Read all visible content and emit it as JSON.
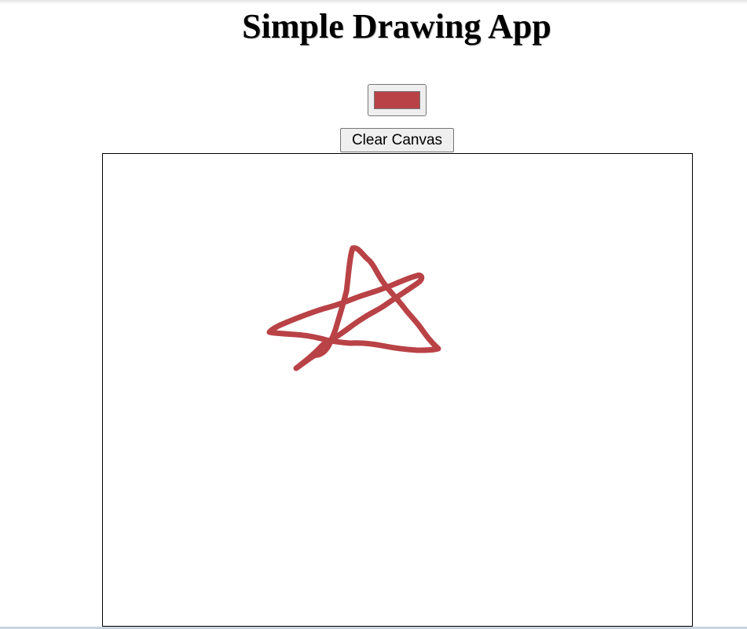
{
  "app": {
    "title": "Simple Drawing App"
  },
  "toolbar": {
    "color_value": "#b94246",
    "clear_label": "Clear Canvas"
  },
  "canvas": {
    "stroke_color": "#b94246"
  }
}
